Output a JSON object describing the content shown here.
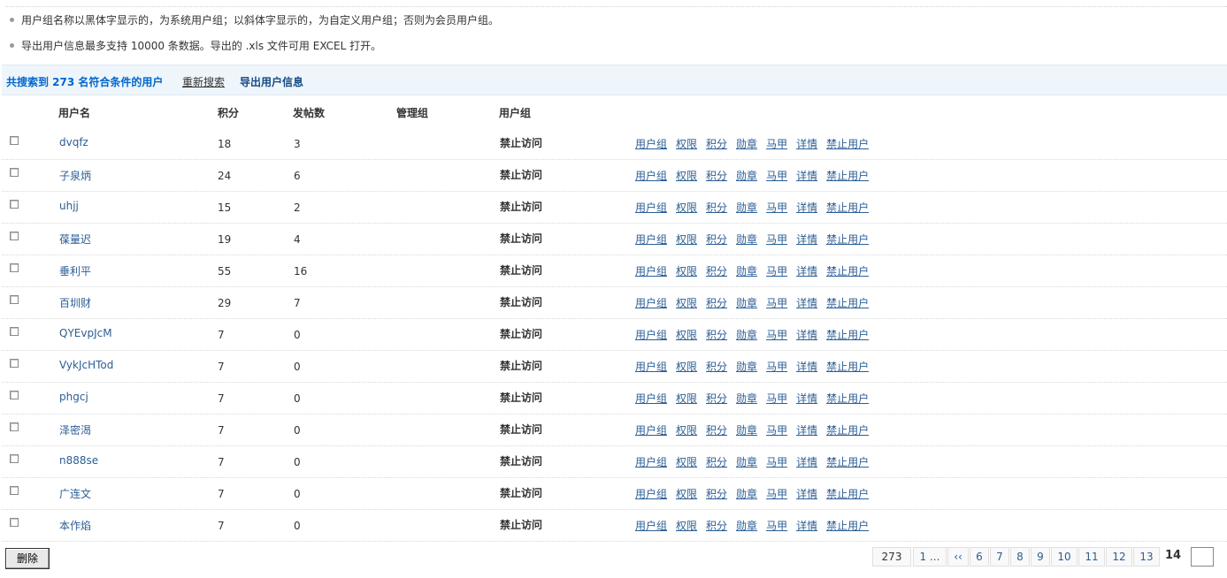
{
  "tips": [
    "用户组名称以黑体字显示的，为系统用户组；以斜体字显示的，为自定义用户组；否则为会员用户组。",
    "导出用户信息最多支持 10000 条数据。导出的 .xls 文件可用 EXCEL 打开。"
  ],
  "summary": {
    "found_text": "共搜索到 273 名符合条件的用户",
    "research_label": "重新搜索",
    "export_label": "导出用户信息"
  },
  "table": {
    "headers": {
      "username": "用户名",
      "credits": "积分",
      "posts": "发帖数",
      "admin_group": "管理组",
      "user_group": "用户组"
    },
    "action_labels": [
      "用户组",
      "权限",
      "积分",
      "勋章",
      "马甲",
      "详情",
      "禁止用户"
    ],
    "rows": [
      {
        "username": "dvqfz",
        "credits": "18",
        "posts": "3",
        "group": "禁止访问"
      },
      {
        "username": "子泉炳",
        "credits": "24",
        "posts": "6",
        "group": "禁止访问"
      },
      {
        "username": "uhjj",
        "credits": "15",
        "posts": "2",
        "group": "禁止访问"
      },
      {
        "username": "葆量迟",
        "credits": "19",
        "posts": "4",
        "group": "禁止访问"
      },
      {
        "username": "垂利平",
        "credits": "55",
        "posts": "16",
        "group": "禁止访问"
      },
      {
        "username": "百圳财",
        "credits": "29",
        "posts": "7",
        "group": "禁止访问"
      },
      {
        "username": "QYEvpJcM",
        "credits": "7",
        "posts": "0",
        "group": "禁止访问"
      },
      {
        "username": "VykJcHTod",
        "credits": "7",
        "posts": "0",
        "group": "禁止访问"
      },
      {
        "username": "phgcj",
        "credits": "7",
        "posts": "0",
        "group": "禁止访问"
      },
      {
        "username": "泽密渴",
        "credits": "7",
        "posts": "0",
        "group": "禁止访问"
      },
      {
        "username": "n888se",
        "credits": "7",
        "posts": "0",
        "group": "禁止访问"
      },
      {
        "username": "广连文",
        "credits": "7",
        "posts": "0",
        "group": "禁止访问"
      },
      {
        "username": "本作焰",
        "credits": "7",
        "posts": "0",
        "group": "禁止访问"
      }
    ]
  },
  "delete_label": "删除",
  "pagination": {
    "total": "273",
    "first": "1 ...",
    "prev": "‹‹",
    "pages": [
      "6",
      "7",
      "8",
      "9",
      "10",
      "11",
      "12",
      "13"
    ],
    "current": "14"
  }
}
